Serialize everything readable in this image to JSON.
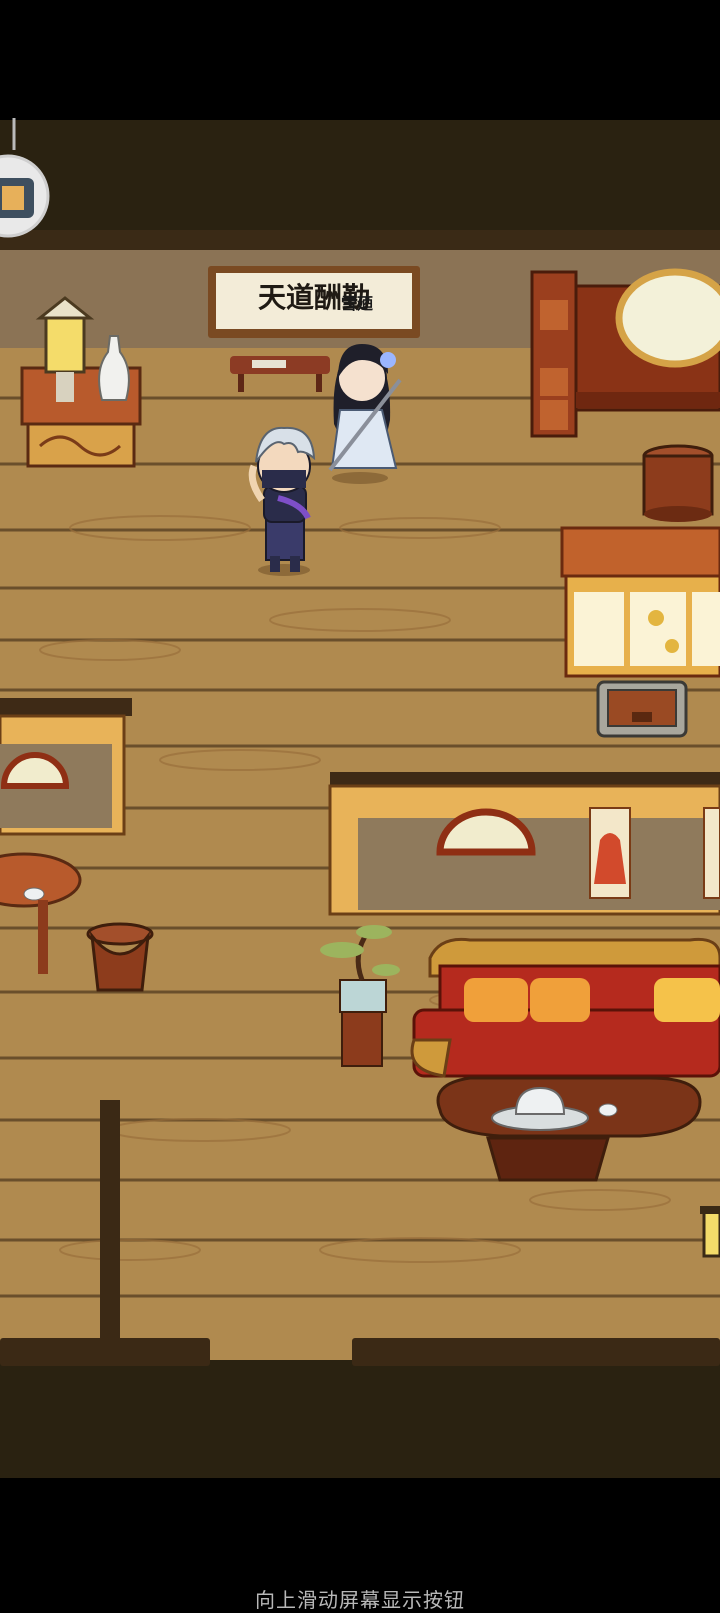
{
  "scene": {
    "plaque_text": "天道酬勤",
    "plaque_overlay": "雪廼"
  },
  "hint": {
    "swipe_text": "向上滑动屏幕显示按钮"
  },
  "icons": {
    "menu_icon": "scroll-menu-icon"
  }
}
